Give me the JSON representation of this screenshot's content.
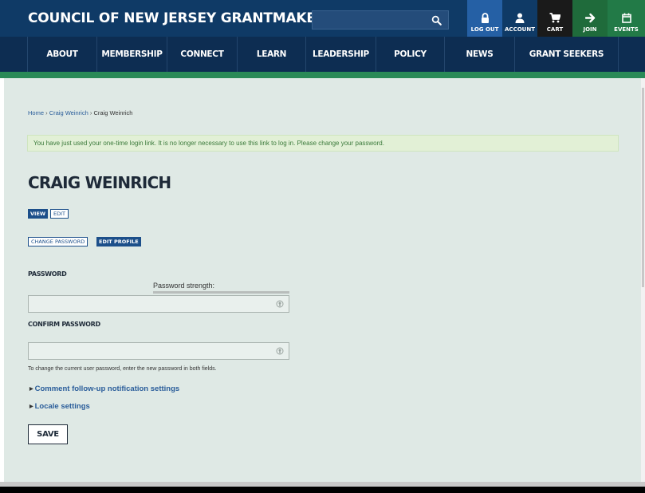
{
  "header": {
    "site_title": "COUNCIL OF NEW JERSEY GRANTMAKERS",
    "search": {
      "placeholder": "",
      "icon": "search-icon"
    },
    "utility_links": [
      {
        "label": "LOG OUT",
        "icon": "lock-icon"
      },
      {
        "label": "ACCOUNT",
        "icon": "user-icon"
      },
      {
        "label": "CART",
        "icon": "cart-icon"
      },
      {
        "label": "JOIN",
        "icon": "arrow-right-icon"
      },
      {
        "label": "EVENTS",
        "icon": "calendar-icon"
      }
    ],
    "colors": {
      "primary": "#0f3a66",
      "nav": "#0d2d52",
      "accent_green": "#2a8a57",
      "active_blue": "#2560a5"
    }
  },
  "nav": {
    "items": [
      "ABOUT",
      "MEMBERSHIP",
      "CONNECT",
      "LEARN",
      "LEADERSHIP",
      "POLICY",
      "NEWS",
      "GRANT SEEKERS"
    ]
  },
  "breadcrumb": {
    "items": [
      "Home",
      "Craig Weinrich",
      "Craig Weinrich"
    ],
    "separator": "›"
  },
  "message": "You have just used your one-time login link. It is no longer necessary to use this link to log in. Please change your password.",
  "page_title": "CRAIG WEINRICH",
  "tabs": {
    "primary": [
      {
        "label": "VIEW",
        "active": true
      },
      {
        "label": "EDIT",
        "active": false
      }
    ],
    "secondary": [
      {
        "label": "CHANGE PASSWORD",
        "active": false
      },
      {
        "label": "EDIT PROFILE",
        "active": true
      }
    ]
  },
  "form": {
    "password_label": "PASSWORD",
    "strength_label": "Password strength:",
    "password_value": "",
    "confirm_label": "CONFIRM PASSWORD",
    "confirm_value": "",
    "help_text": "To change the current user password, enter the new password in both fields.",
    "details": [
      "Comment follow-up notification settings",
      "Locale settings"
    ],
    "save_label": "SAVE"
  }
}
